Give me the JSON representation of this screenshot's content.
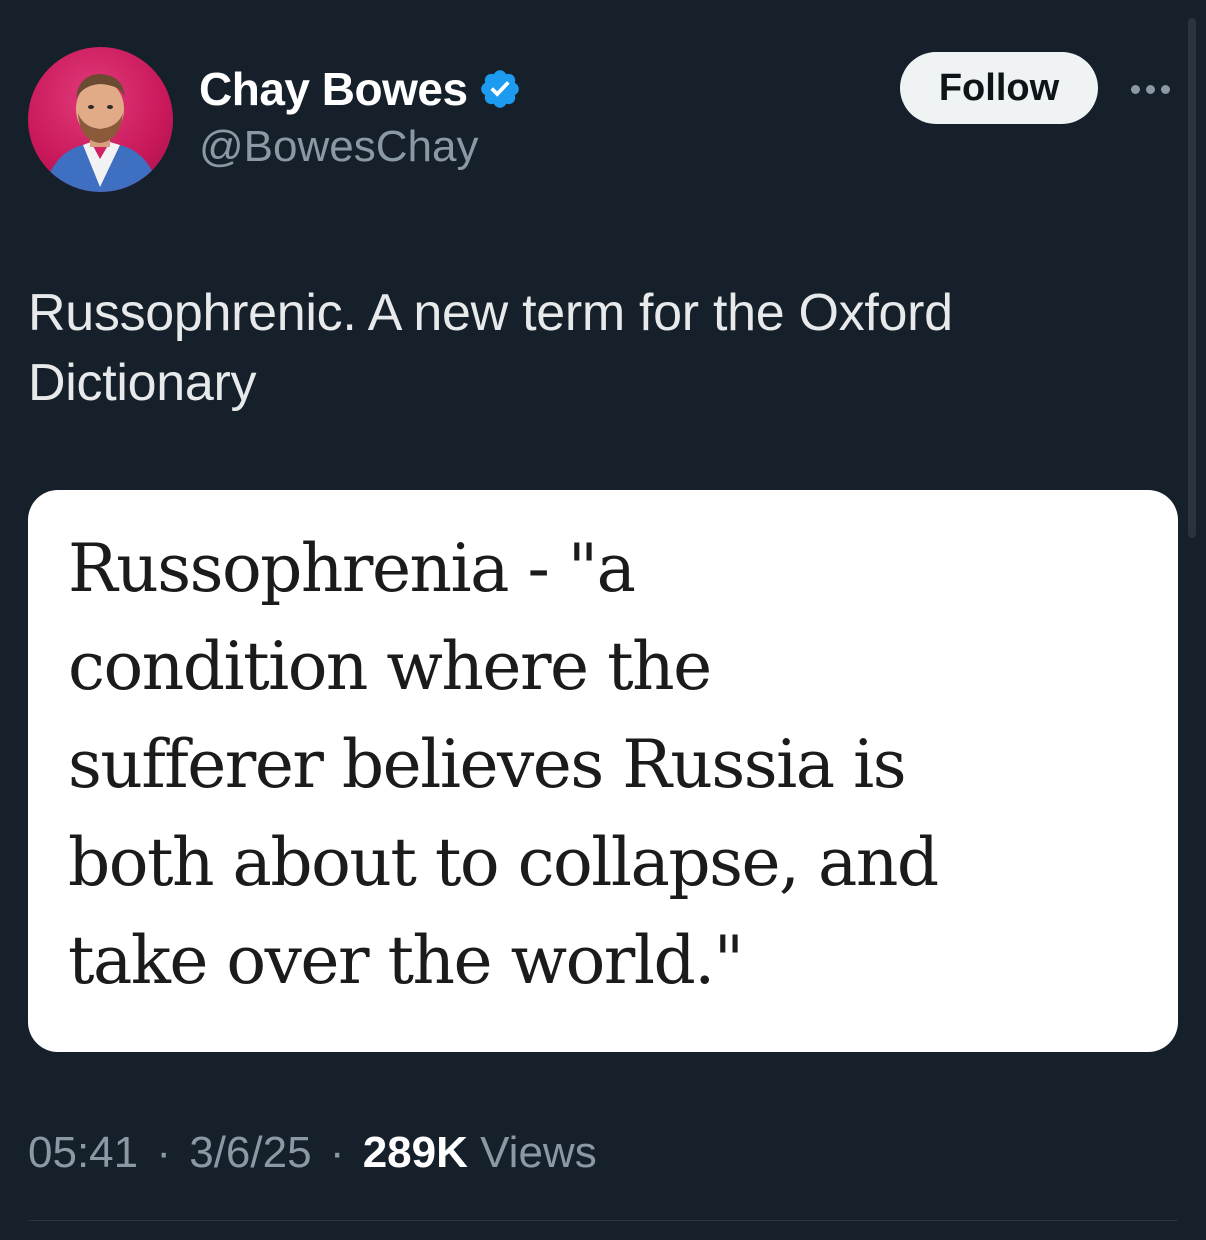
{
  "author": {
    "display_name": "Chay Bowes",
    "handle": "@BowesChay",
    "verified": true,
    "avatar_bg_color": "#d11f63"
  },
  "actions": {
    "follow_label": "Follow",
    "more_icon": "more-horizontal-icon"
  },
  "tweet": {
    "text_line_1": "Russophrenic. A new term for the Oxford",
    "text_line_2": "Dictionary"
  },
  "media": {
    "lines": [
      "Russophrenia - \"a",
      "condition where the",
      "sufferer believes Russia is",
      "both about to collapse, and",
      "take over the world.\""
    ]
  },
  "meta": {
    "time": "05:41",
    "date": "3/6/25",
    "views_count": "289K",
    "views_label": "Views",
    "separator": "·"
  },
  "colors": {
    "background": "#16202b",
    "accent_verified": "#1d9bf0",
    "text_primary": "#e7e9ea",
    "text_secondary": "#8b98a5"
  }
}
